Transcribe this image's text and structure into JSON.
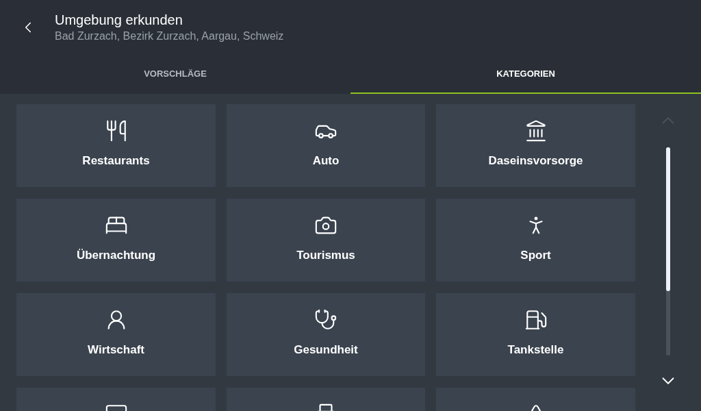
{
  "header": {
    "title": "Umgebung erkunden",
    "subtitle": "Bad Zurzach, Bezirk Zurzach, Aargau, Schweiz"
  },
  "tabs": [
    {
      "label": "VORSCHLÄGE",
      "selected": false
    },
    {
      "label": "KATEGORIEN",
      "selected": true
    }
  ],
  "categories": [
    {
      "kind": "cutlery",
      "label": "Restaurants"
    },
    {
      "kind": "car",
      "label": "Auto"
    },
    {
      "kind": "landmark",
      "label": "Daseinsvorsorge"
    },
    {
      "kind": "bed",
      "label": "Übernachtung"
    },
    {
      "kind": "camera",
      "label": "Tourismus"
    },
    {
      "kind": "person",
      "label": "Sport"
    },
    {
      "kind": "user",
      "label": "Wirtschaft"
    },
    {
      "kind": "stethoscope",
      "label": "Gesundheit"
    },
    {
      "kind": "fuel",
      "label": "Tankstelle"
    },
    {
      "kind": "monitor"
    },
    {
      "kind": "printer"
    },
    {
      "kind": "triangle"
    }
  ]
}
